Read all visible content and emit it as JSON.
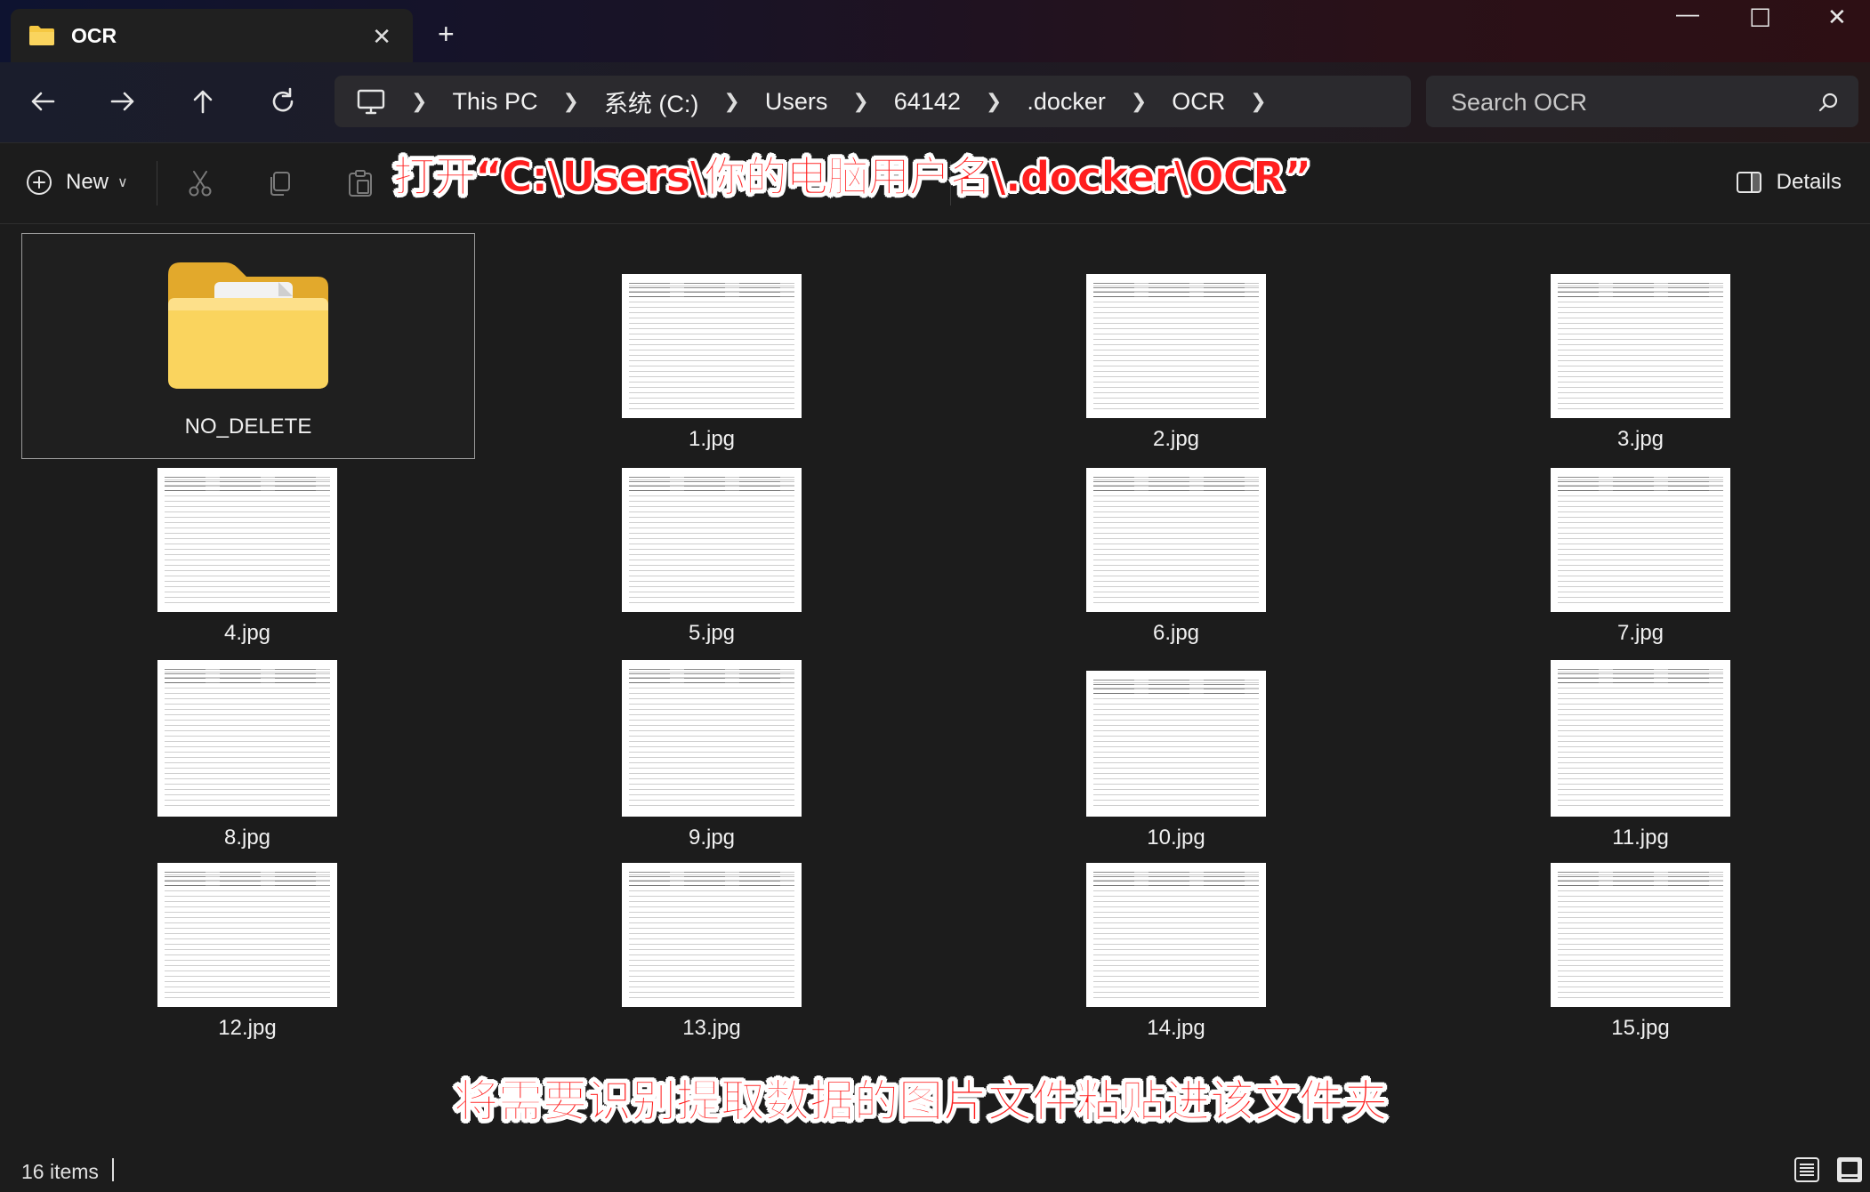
{
  "window": {
    "tab_title": "OCR",
    "tab_close": "✕",
    "new_tab": "+",
    "minimize": "—",
    "maximize": "☐",
    "close": "✕"
  },
  "nav": {
    "breadcrumb": [
      "This PC",
      "系统 (C:)",
      "Users",
      "64142",
      ".docker",
      "OCR"
    ],
    "search_placeholder": "Search OCR"
  },
  "command_bar": {
    "new_label": "New",
    "details_label": "Details"
  },
  "files": [
    {
      "name": "NO_DELETE",
      "type": "folder"
    },
    {
      "name": "1.jpg",
      "type": "image"
    },
    {
      "name": "2.jpg",
      "type": "image"
    },
    {
      "name": "3.jpg",
      "type": "image"
    },
    {
      "name": "4.jpg",
      "type": "image"
    },
    {
      "name": "5.jpg",
      "type": "image"
    },
    {
      "name": "6.jpg",
      "type": "image"
    },
    {
      "name": "7.jpg",
      "type": "image"
    },
    {
      "name": "8.jpg",
      "type": "image"
    },
    {
      "name": "9.jpg",
      "type": "image"
    },
    {
      "name": "10.jpg",
      "type": "image"
    },
    {
      "name": "11.jpg",
      "type": "image"
    },
    {
      "name": "12.jpg",
      "type": "image"
    },
    {
      "name": "13.jpg",
      "type": "image"
    },
    {
      "name": "14.jpg",
      "type": "image"
    },
    {
      "name": "15.jpg",
      "type": "image"
    }
  ],
  "status": {
    "item_count": "16 items"
  },
  "captions": {
    "top": "打开“C:\\Users\\你的电脑用户名\\.docker\\OCR”",
    "bottom": "将需要识别提取数据的图片文件粘贴进该文件夹"
  },
  "colors": {
    "caption_red": "#ff1e1e",
    "folder_yellow": "#f6c842",
    "window_bg": "#1c1c1c"
  }
}
